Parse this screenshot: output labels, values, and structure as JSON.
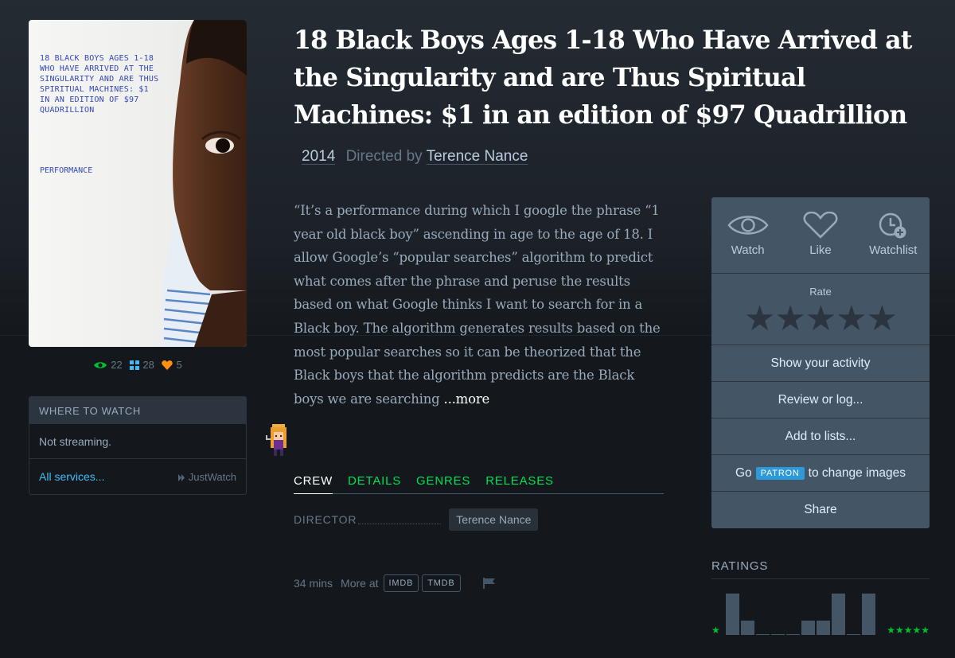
{
  "film": {
    "title": "18 Black Boys Ages 1-18 Who Have Arrived at the Singularity and are Thus Spiritual Machines: $1 in an edition of $97 Quadrillion",
    "year": "2014",
    "directed_by_label": "Directed by",
    "director": "Terence Nance"
  },
  "poster": {
    "text": "18 BLACK BOYS AGES 1-18 WHO HAVE ARRIVED AT THE SINGULARITY AND ARE THUS SPIRITUAL MACHINES: $1 IN AN EDITION OF $97 QUADRILLION",
    "subtitle": "PERFORMANCE",
    "text_color": "#3448b8"
  },
  "stats": {
    "watched": "22",
    "lists": "28",
    "likes": "5",
    "watched_icon": "eye-icon",
    "lists_icon": "grid-icon",
    "likes_icon": "heart-icon"
  },
  "where_to_watch": {
    "heading": "Where to watch",
    "status": "Not streaming.",
    "all_services": "All services...",
    "provider": "JustWatch"
  },
  "synopsis": {
    "text": "“It’s a performance during which I google the phrase “1 year old black boy” ascending in age to the age of 18. I allow Google’s “popular searches” algorithm to predict what comes after the phrase and peruse the results based on what Google thinks I want to search for in a Black boy. The algorithm generates results based on the most popular searches so it can be theorized that the Black boys that the algorithm predicts are the Black boys we are searching ",
    "more": "...more"
  },
  "tabs": [
    {
      "label": "Crew",
      "active": true
    },
    {
      "label": "Details",
      "active": false
    },
    {
      "label": "Genres",
      "active": false
    },
    {
      "label": "Releases",
      "active": false
    }
  ],
  "crew": {
    "role": "Director",
    "name": "Terence Nance"
  },
  "footer": {
    "runtime": "34 mins",
    "more_at": "More at",
    "imdb": "IMDB",
    "tmdb": "TMDB",
    "flag_icon": "flag-icon"
  },
  "actions": {
    "watch": "Watch",
    "like": "Like",
    "watchlist": "Watchlist",
    "rate": "Rate",
    "show_activity": "Show your activity",
    "review": "Review or log...",
    "add_lists": "Add to lists...",
    "go": "Go",
    "patron": "PATRON",
    "change_images": "to change images",
    "share": "Share"
  },
  "ratings": {
    "heading": "Ratings",
    "low_star": "★",
    "high_stars": "★★★★★",
    "histogram": [
      0,
      1.0,
      0.35,
      0.02,
      0.02,
      0.02,
      0.35,
      0.35,
      1.0,
      0.02,
      1.0
    ],
    "bar_color": "#456",
    "star_color": "#00c030"
  },
  "colors": {
    "accent_green": "#00e054",
    "link_blue": "#40bcf4",
    "panel": "#456",
    "heart_orange": "#ff9010"
  }
}
